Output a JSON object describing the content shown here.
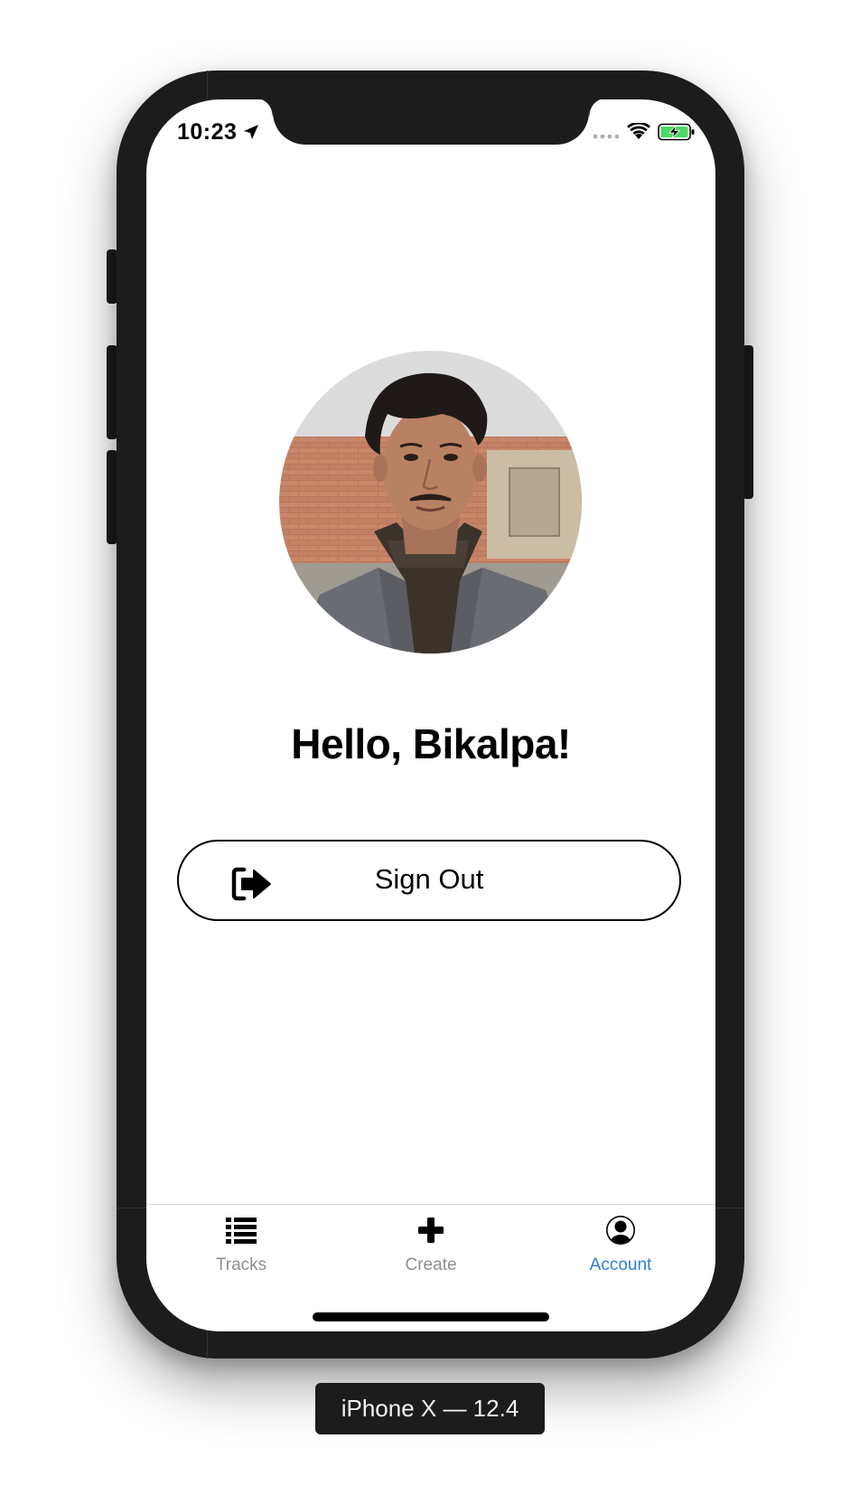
{
  "status_bar": {
    "time": "10:23",
    "icons": [
      "location-arrow-icon",
      "cellular-signal-icon",
      "wifi-icon",
      "battery-charging-icon"
    ],
    "battery_color": "#4cd964"
  },
  "profile": {
    "avatar_icon": "profile-photo",
    "greeting": "Hello, Bikalpa!"
  },
  "actions": {
    "sign_out_label": "Sign Out",
    "sign_out_icon": "sign-out-icon"
  },
  "tab_bar": {
    "items": [
      {
        "label": "Tracks",
        "icon": "list-icon",
        "active": false
      },
      {
        "label": "Create",
        "icon": "plus-icon",
        "active": false
      },
      {
        "label": "Account",
        "icon": "user-circle-icon",
        "active": true
      }
    ],
    "active_color": "#2f7fd8",
    "inactive_color": "#8e8e93"
  },
  "simulator": {
    "caption": "iPhone X — 12.4"
  }
}
